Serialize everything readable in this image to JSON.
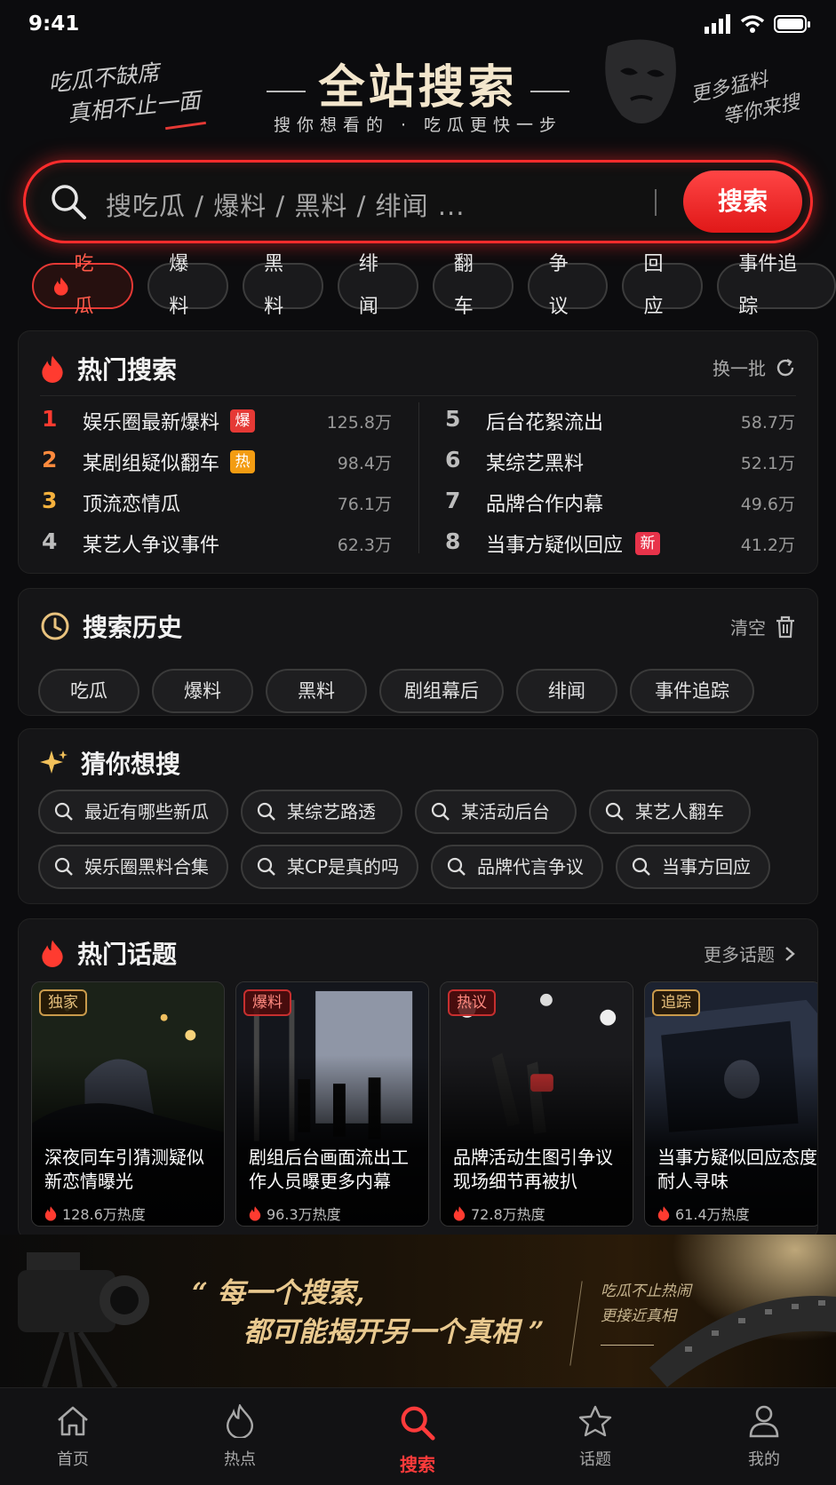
{
  "status_bar": {
    "time": "9:41"
  },
  "hero": {
    "slogan_left": [
      "吃瓜不缺席",
      "真相不止一面"
    ],
    "title": "全站搜索",
    "subtitle": "搜你想看的 · 吃瓜更快一步",
    "slogan_right": [
      "更多猛料",
      "等你来搜"
    ]
  },
  "search": {
    "placeholder": "搜吃瓜 / 爆料 / 黑料 / 绯闻 ...",
    "button_label": "搜索"
  },
  "category_chips": [
    {
      "label": "吃瓜",
      "active": true
    },
    {
      "label": "爆料"
    },
    {
      "label": "黑料"
    },
    {
      "label": "绯闻"
    },
    {
      "label": "翻车"
    },
    {
      "label": "争议"
    },
    {
      "label": "回应"
    },
    {
      "label": "事件追踪"
    }
  ],
  "hot_search": {
    "title": "热门搜索",
    "refresh_label": "换一批",
    "items": [
      {
        "rank": "1",
        "name": "娱乐圈最新爆料",
        "badge": "爆",
        "count": "125.8万"
      },
      {
        "rank": "2",
        "name": "某剧组疑似翻车",
        "badge": "热",
        "count": "98.4万"
      },
      {
        "rank": "3",
        "name": "顶流恋情瓜",
        "badge": "",
        "count": "76.1万"
      },
      {
        "rank": "4",
        "name": "某艺人争议事件",
        "badge": "",
        "count": "62.3万"
      },
      {
        "rank": "5",
        "name": "后台花絮流出",
        "badge": "",
        "count": "58.7万"
      },
      {
        "rank": "6",
        "name": "某综艺黑料",
        "badge": "",
        "count": "52.1万"
      },
      {
        "rank": "7",
        "name": "品牌合作内幕",
        "badge": "",
        "count": "49.6万"
      },
      {
        "rank": "8",
        "name": "当事方疑似回应",
        "badge": "新",
        "count": "41.2万"
      }
    ],
    "colors": {
      "rank1": "#ff3b30",
      "rank2": "#ff8a3d",
      "rank3": "#f5b13d",
      "badge_bao": "#e53935",
      "badge_re": "#f39c12",
      "badge_xin": "#e8334a"
    }
  },
  "history": {
    "title": "搜索历史",
    "clear_label": "清空",
    "tags": [
      "吃瓜",
      "爆料",
      "黑料",
      "剧组幕后",
      "绯闻",
      "事件追踪"
    ]
  },
  "guess": {
    "title": "猜你想搜",
    "rows": [
      [
        "最近有哪些新瓜",
        "某综艺路透",
        "某活动后台",
        "某艺人翻车"
      ],
      [
        "娱乐圈黑料合集",
        "某CP是真的吗",
        "品牌代言争议",
        "当事方回应"
      ]
    ]
  },
  "topics": {
    "title": "热门话题",
    "more_label": "更多话题",
    "items": [
      {
        "tag": "独家",
        "title": "深夜同车引猜测疑似新恋情曝光",
        "heat": "128.6万热度"
      },
      {
        "tag": "爆料",
        "title": "剧组后台画面流出工作人员曝更多内幕",
        "heat": "96.3万热度"
      },
      {
        "tag": "热议",
        "title": "品牌活动生图引争议现场细节再被扒",
        "heat": "72.8万热度"
      },
      {
        "tag": "追踪",
        "title": "当事方疑似回应态度耐人寻味",
        "heat": "61.4万热度"
      }
    ]
  },
  "banner": {
    "quote_line1": "每一个搜索,",
    "quote_line2": "都可能揭开另一个真相",
    "side_line1": "吃瓜不止热闹",
    "side_line2": "更接近真相"
  },
  "tabbar": [
    {
      "label": "首页",
      "icon": "home-icon"
    },
    {
      "label": "热点",
      "icon": "flame-icon"
    },
    {
      "label": "搜索",
      "icon": "search-icon",
      "active": true
    },
    {
      "label": "话题",
      "icon": "star-icon"
    },
    {
      "label": "我的",
      "icon": "user-icon"
    }
  ],
  "accent": "#ff2c2c"
}
